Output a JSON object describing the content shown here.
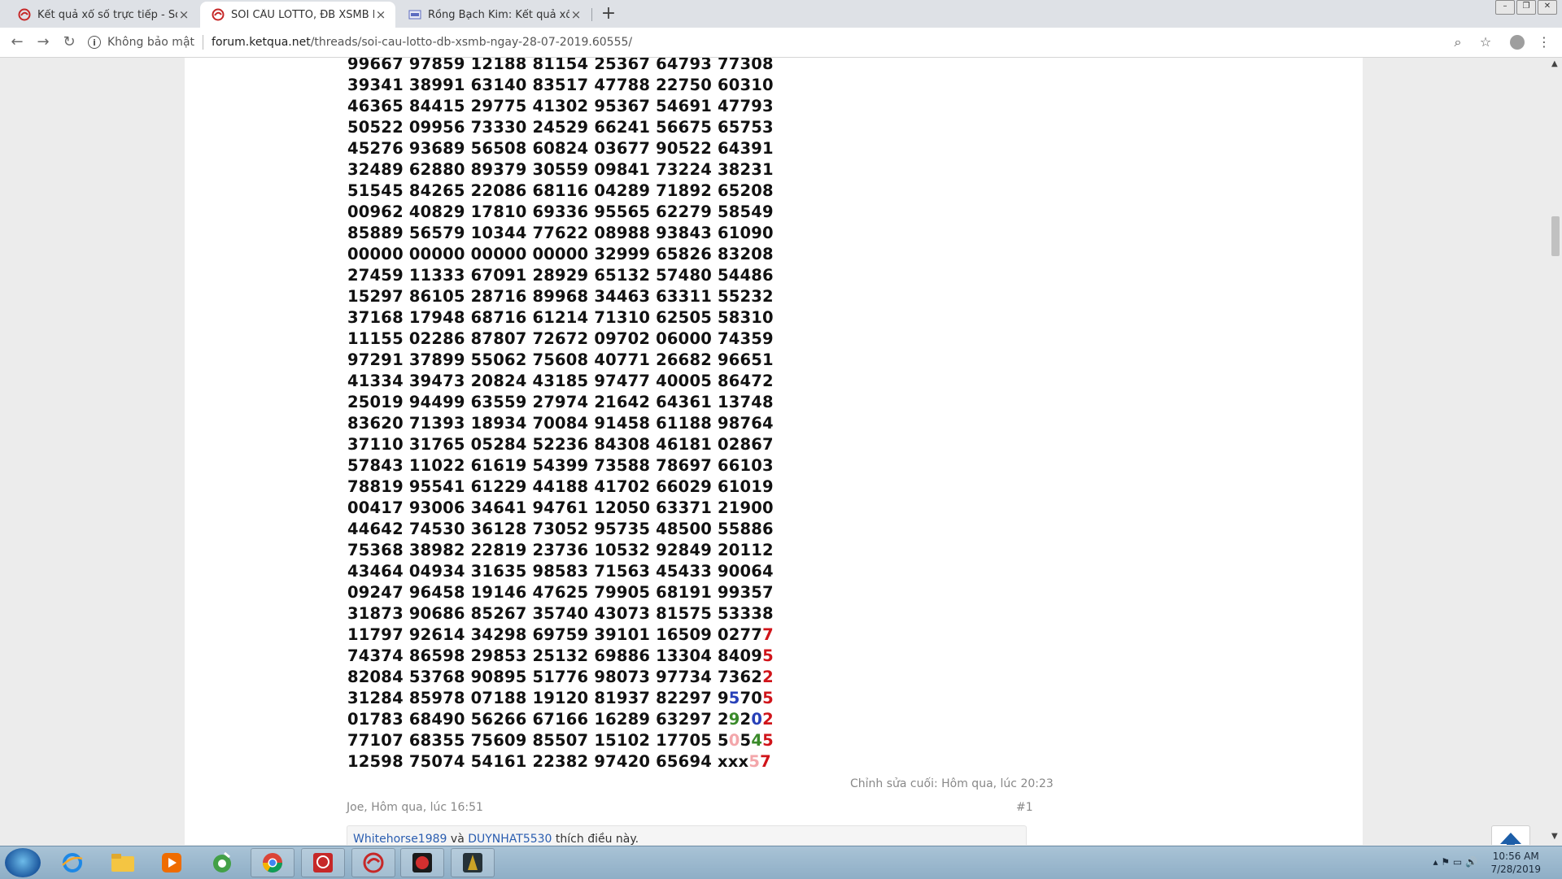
{
  "browser": {
    "tabs": [
      {
        "title": "Kết quả xổ số trực tiếp - Soi cầu,",
        "active": false
      },
      {
        "title": "SOI CẦU LOTTO, ĐB XSMB NGÀY",
        "active": true
      },
      {
        "title": "Rồng Bạch Kim: Kết quả xổ số m",
        "active": false
      }
    ],
    "new_tab": "+",
    "security_text": "Không bảo mật",
    "url_host": "forum.ketqua.net",
    "url_path": "/threads/soi-cau-lotto-db-xsmb-ngay-28-07-2019.60555/"
  },
  "post": {
    "rows": [
      "99667 97859 12188 81154 25367 64793 77308",
      "39341 38991 63140 83517 47788 22750 60310",
      "46365 84415 29775 41302 95367 54691 47793",
      "50522 09956 73330 24529 66241 56675 65753",
      "45276 93689 56508 60824 03677 90522 64391",
      "32489 62880 89379 30559 09841 73224 38231",
      "51545 84265 22086 68116 04289 71892 65208",
      "00962 40829 17810 69336 95565 62279 58549",
      "85889 56579 10344 77622 08988 93843 61090",
      "00000 00000 00000 00000 32999 65826 83208",
      "27459 11333 67091 28929 65132 57480 54486",
      "15297 86105 28716 89968 34463 63311 55232",
      "37168 17948 68716 61214 71310 62505 58310",
      "11155 02286 87807 72672 09702 06000 74359",
      "97291 37899 55062 75608 40771 26682 96651",
      "41334 39473 20824 43185 97477 40005 86472",
      "25019 94499 63559 27974 21642 64361 13748",
      "83620 71393 18934 70084 91458 61188 98764",
      "37110 31765 05284 52236 84308 46181 02867",
      "57843 11022 61619 54399 73588 78697 66103",
      "78819 95541 61229 44188 41702 66029 61019",
      "00417 93006 34641 94761 12050 63371 21900",
      "44642 74530 36128 73052 95735 48500 55886",
      "75368 38982 22819 23736 10532 92849 20112",
      "43464 04934 31635 98583 71563 45433 90064",
      "09247 96458 19146 47625 79905 68191 99357",
      "31873 90686 85267 35740 43073 81575 53338"
    ],
    "colored_rows": [
      {
        "prefix": "11797 92614 34298 69759 39101 16509 0277",
        "segs": [
          [
            "7",
            "red"
          ]
        ]
      },
      {
        "prefix": "74374 86598 29853 25132 69886 13304 8409",
        "segs": [
          [
            "5",
            "red"
          ]
        ]
      },
      {
        "prefix": "82084 53768 90895 51776 98073 97734 7362",
        "segs": [
          [
            "2",
            "red"
          ]
        ]
      },
      {
        "prefix": "31284 85978 07188 19120 81937 82297 9",
        "segs": [
          [
            "5",
            "blue"
          ],
          [
            "70",
            ""
          ],
          [
            "5",
            "red"
          ]
        ]
      },
      {
        "prefix": "01783 68490 56266 67166 16289 63297 2",
        "segs": [
          [
            "9",
            "green"
          ],
          [
            "2",
            ""
          ],
          [
            "0",
            "blue"
          ],
          [
            "2",
            "red"
          ]
        ]
      },
      {
        "prefix": "77107 68355 75609 85507 15102 17705 5",
        "segs": [
          [
            "0",
            "pink"
          ],
          [
            "5",
            ""
          ],
          [
            "4",
            "green"
          ],
          [
            "5",
            "red"
          ]
        ]
      },
      {
        "prefix": "12598 75074 54161 22382 97420 65694 xxx",
        "segs": [
          [
            "5",
            "pink"
          ],
          [
            "7",
            "red"
          ]
        ]
      }
    ],
    "edit_note": "Chỉnh sửa cuối: Hôm qua, lúc 20:23",
    "author_line": "Joe, Hôm qua, lúc 16:51",
    "post_number": "#1",
    "likes": {
      "user1": "Whitehorse1989",
      "conj": " và ",
      "user2": "DUYNHAT5530",
      "suffix": " thích điều này."
    }
  },
  "taskbar": {
    "time": "10:56 AM",
    "date": "7/28/2019",
    "apps": [
      "ie-icon",
      "folder-icon",
      "media-player-icon",
      "green-app-icon",
      "chrome-icon",
      "red-app-icon",
      "ketqua-app-icon",
      "game-red-icon",
      "game-gold-icon"
    ]
  },
  "colors": {
    "red": "#d0141a",
    "blue": "#2740b8",
    "green": "#3a8a2a",
    "link": "#2a5db0",
    "scroll_top_arrow": "#1d5ea8"
  }
}
